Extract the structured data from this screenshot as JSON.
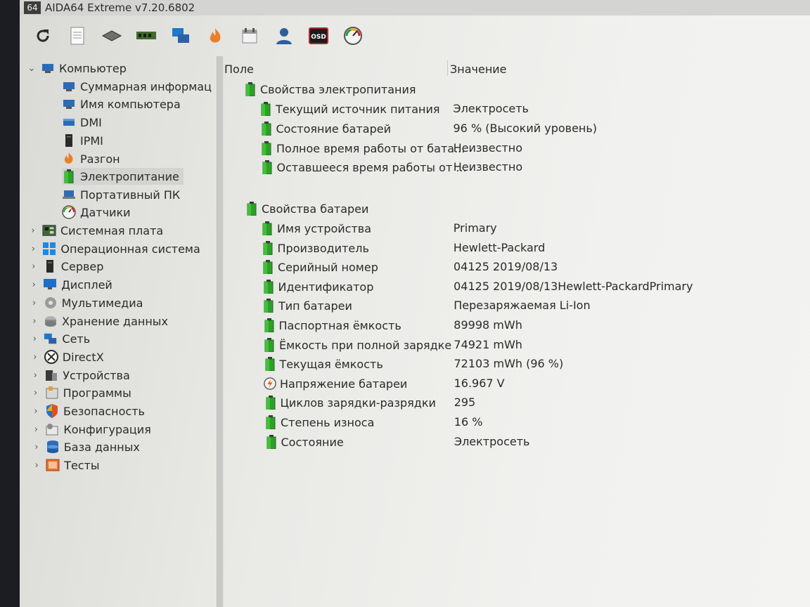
{
  "window": {
    "badge": "64",
    "title": "AIDA64 Extreme v7.20.6802"
  },
  "toolbar": {
    "buttons": [
      "refresh-icon",
      "report-icon",
      "motherboard-chip-icon",
      "memory-icon",
      "network-icon",
      "overclock-flame-icon",
      "calendar-icon",
      "user-icon",
      "osd-icon",
      "gauge-icon"
    ],
    "osd_label": "OSD"
  },
  "tree": {
    "root": "Компьютер",
    "children": [
      "Суммарная информац",
      "Имя компьютера",
      "DMI",
      "IPMI",
      "Разгон",
      "Электропитание",
      "Портативный ПК",
      "Датчики"
    ],
    "categories": [
      "Системная плата",
      "Операционная система",
      "Сервер",
      "Дисплей",
      "Мультимедиа",
      "Хранение данных",
      "Сеть",
      "DirectX",
      "Устройства",
      "Программы",
      "Безопасность",
      "Конфигурация",
      "База данных",
      "Тесты"
    ]
  },
  "columns": {
    "field": "Поле",
    "value": "Значение"
  },
  "sections": [
    {
      "title": "Свойства электропитания",
      "rows": [
        {
          "field": "Текущий источник питания",
          "value": "Электросеть"
        },
        {
          "field": "Состояние батарей",
          "value": "96 % (Высокий уровень)"
        },
        {
          "field": "Полное время работы от бата...",
          "value": "Неизвестно"
        },
        {
          "field": "Оставшееся время работы от ...",
          "value": "Неизвестно"
        }
      ]
    },
    {
      "title": "Свойства батареи",
      "rows": [
        {
          "field": "Имя устройства",
          "value": "Primary"
        },
        {
          "field": "Производитель",
          "value": "Hewlett-Packard"
        },
        {
          "field": "Серийный номер",
          "value": "04125 2019/08/13"
        },
        {
          "field": "Идентификатор",
          "value": "04125 2019/08/13Hewlett-PackardPrimary"
        },
        {
          "field": "Тип батареи",
          "value": "Перезаряжаемая Li-Ion"
        },
        {
          "field": "Паспортная ёмкость",
          "value": "89998 mWh"
        },
        {
          "field": "Ёмкость при полной зарядке",
          "value": "74921 mWh"
        },
        {
          "field": "Текущая ёмкость",
          "value": "72103 mWh  (96 %)"
        },
        {
          "field": "Напряжение батареи",
          "value": "16.967 V"
        },
        {
          "field": "Циклов зарядки-разрядки",
          "value": "295"
        },
        {
          "field": "Степень износа",
          "value": "16 %"
        },
        {
          "field": "Состояние",
          "value": "Электросеть"
        }
      ]
    }
  ],
  "colors": {
    "battery_green": "#2f9e2a",
    "selection": "#d3d3d1"
  }
}
